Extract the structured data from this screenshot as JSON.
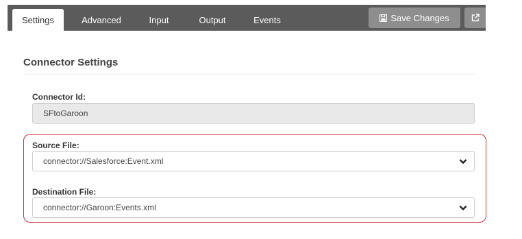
{
  "tabs": [
    {
      "label": "Settings",
      "active": true
    },
    {
      "label": "Advanced",
      "active": false
    },
    {
      "label": "Input",
      "active": false
    },
    {
      "label": "Output",
      "active": false
    },
    {
      "label": "Events",
      "active": false
    }
  ],
  "toolbar": {
    "save_label": "Save Changes",
    "save_icon": "floppy-disk-icon",
    "external_icon": "external-link-icon"
  },
  "section": {
    "title": "Connector Settings"
  },
  "fields": {
    "connector_id": {
      "label": "Connector Id:",
      "value": "SFtoGaroon"
    },
    "source_file": {
      "label": "Source File:",
      "value": "connector://Salesforce:Event.xml"
    },
    "destination_file": {
      "label": "Destination File:",
      "value": "connector://Garoon:Events.xml"
    }
  },
  "colors": {
    "tab_bar": "#5b5b5b",
    "button": "#8e8e8e",
    "highlight": "#cc2b33",
    "readonly_bg": "#e9e9e9"
  }
}
